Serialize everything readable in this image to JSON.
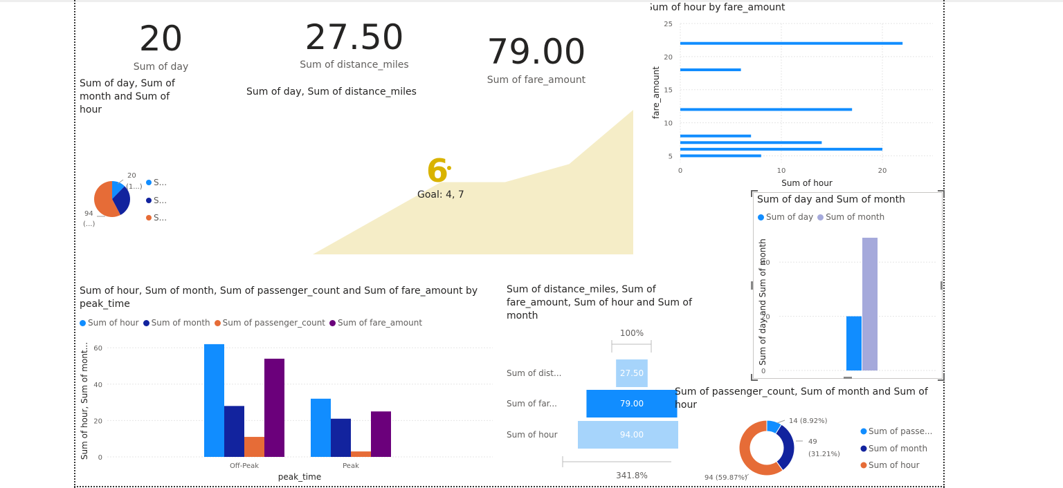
{
  "kpi_day": {
    "value": "20",
    "label": "Sum of day"
  },
  "kpi_distance": {
    "value": "27.50",
    "label": "Sum of distance_miles"
  },
  "kpi_fare": {
    "value": "79.00",
    "label": "Sum of fare_amount"
  },
  "pie": {
    "title": "Sum of day, Sum of month and Sum of hour",
    "label_top": "20",
    "label_top_sub": "(1...)",
    "label_bottom": "94",
    "label_bottom_sub": "(...)",
    "legend": [
      "S...",
      "S...",
      "S..."
    ]
  },
  "kpi_goal": {
    "title": "Sum of day, Sum of distance_miles",
    "value": "6",
    "goal_label": "Goal: 4, 7"
  },
  "colors": {
    "blue": "#118DFF",
    "navy": "#12239E",
    "orange": "#E66C37",
    "purple": "#6B007B",
    "lavender": "#A5A9DB",
    "lightblue": "#A6D4FB",
    "gold": "#D9B300",
    "sand": "#F5EDC7"
  },
  "hbar": {
    "title": "Sum of hour by fare_amount",
    "xlabel": "Sum of hour",
    "ylabel": "fare_amount"
  },
  "daymonth": {
    "title": "Sum of day and Sum of month",
    "legend": [
      "Sum of day",
      "Sum of month"
    ],
    "ylabel": "Sum of day and Sum of month"
  },
  "clustered": {
    "title": "Sum of hour, Sum of month, Sum of passenger_count and Sum of fare_amount by peak_time",
    "legend": [
      "Sum of hour",
      "Sum of month",
      "Sum of passenger_count",
      "Sum of fare_amount"
    ],
    "ylabel": "Sum of hour, Sum of mont...",
    "xlabel": "peak_time"
  },
  "funnel": {
    "title": "Sum of distance_miles, Sum of fare_amount, Sum of hour and Sum of month",
    "top_pct": "100%",
    "bottom_pct": "341.8%",
    "rows": [
      {
        "label": "Sum of dist...",
        "value": "27.50"
      },
      {
        "label": "Sum of far...",
        "value": "79.00"
      },
      {
        "label": "Sum of hour",
        "value": "94.00"
      }
    ]
  },
  "donut": {
    "title": "Sum of passenger_count, Sum of month and Sum of hour",
    "labels": [
      "14 (8.92%)",
      "49",
      "(31.21%)",
      "94 (59.87%)"
    ],
    "legend": [
      "Sum of passe...",
      "Sum of month",
      "Sum of hour"
    ]
  },
  "chart_data": [
    {
      "type": "pie",
      "title": "Sum of day, Sum of month and Sum of hour",
      "values": [
        20,
        49,
        94
      ]
    },
    {
      "type": "area",
      "title": "Sum of day, Sum of distance_miles",
      "values": [
        0,
        2,
        4,
        4,
        5,
        8
      ]
    },
    {
      "type": "bar",
      "orientation": "horizontal",
      "title": "Sum of hour by fare_amount",
      "xlabel": "Sum of hour",
      "ylabel": "fare_amount",
      "y": [
        22,
        18,
        12,
        8,
        7,
        6,
        5
      ],
      "values": [
        22,
        6,
        17,
        7,
        14,
        20,
        8
      ],
      "xlim": [
        0,
        25
      ],
      "ylim": [
        4,
        25
      ],
      "xticks": [
        0,
        10,
        20
      ],
      "yticks": [
        5,
        10,
        15,
        20,
        25
      ]
    },
    {
      "type": "bar",
      "title": "Sum of day and Sum of month",
      "ylabel": "Sum of day and Sum of month",
      "categories": [
        ""
      ],
      "series": [
        {
          "name": "Sum of day",
          "values": [
            20
          ]
        },
        {
          "name": "Sum of month",
          "values": [
            49
          ]
        }
      ],
      "ylim": [
        0,
        50
      ],
      "yticks": [
        0,
        20,
        40
      ]
    },
    {
      "type": "bar",
      "title": "Sum of hour, Sum of month, Sum of passenger_count and Sum of fare_amount by peak_time",
      "xlabel": "peak_time",
      "ylabel": "Sum of hour, Sum of mont...",
      "categories": [
        "Off-Peak",
        "Peak"
      ],
      "series": [
        {
          "name": "Sum of hour",
          "values": [
            62,
            32
          ]
        },
        {
          "name": "Sum of month",
          "values": [
            28,
            21
          ]
        },
        {
          "name": "Sum of passenger_count",
          "values": [
            11,
            3
          ]
        },
        {
          "name": "Sum of fare_amount",
          "values": [
            54,
            25
          ]
        }
      ],
      "ylim": [
        0,
        65
      ],
      "yticks": [
        0,
        20,
        40,
        60
      ]
    },
    {
      "type": "bar",
      "orientation": "funnel",
      "title": "Sum of distance_miles, Sum of fare_amount, Sum of hour and Sum of month",
      "categories": [
        "Sum of dist...",
        "Sum of far...",
        "Sum of hour"
      ],
      "values": [
        27.5,
        79,
        94
      ]
    },
    {
      "type": "pie",
      "title": "Sum of passenger_count, Sum of month and Sum of hour",
      "categories": [
        "Sum of passe...",
        "Sum of month",
        "Sum of hour"
      ],
      "values": [
        14,
        49,
        94
      ]
    }
  ]
}
